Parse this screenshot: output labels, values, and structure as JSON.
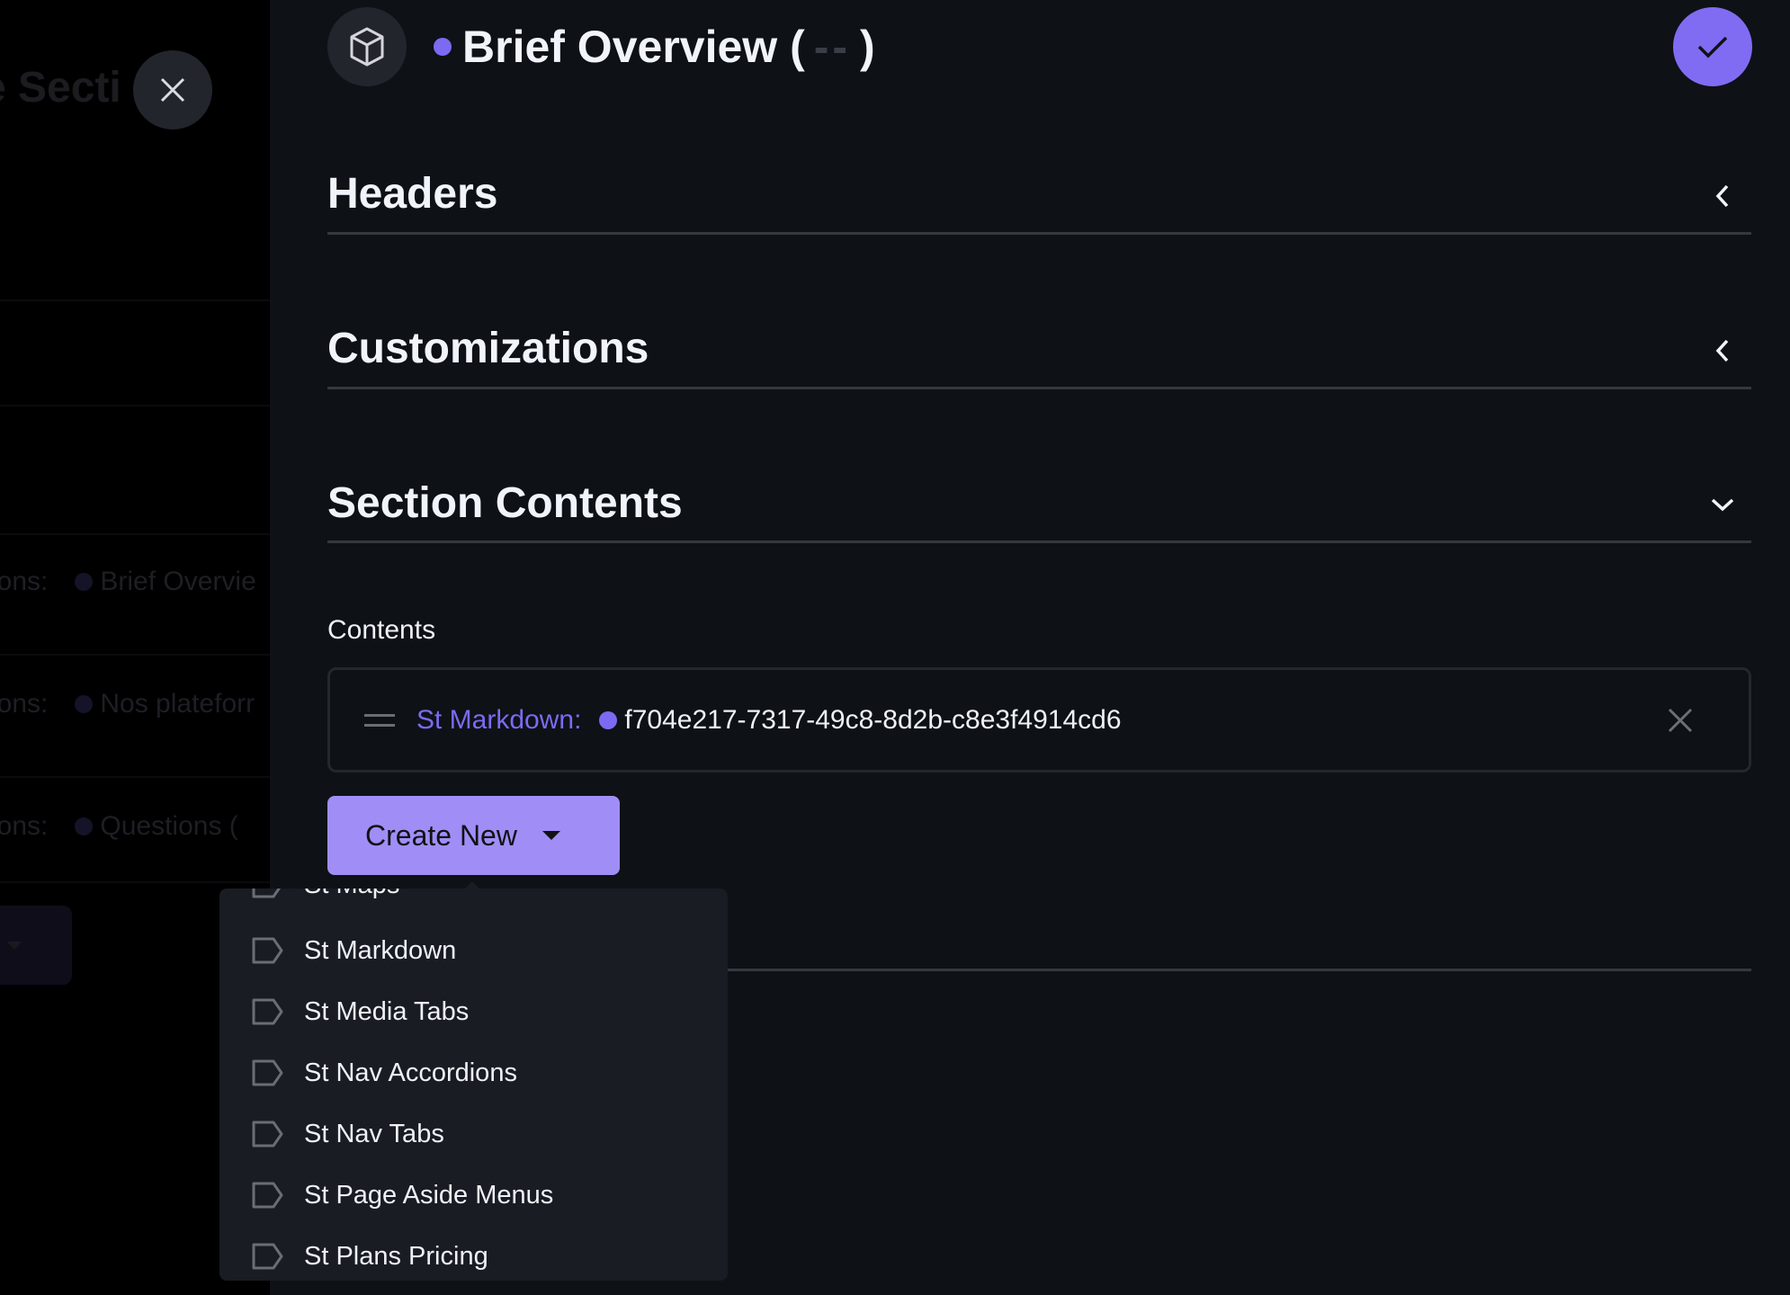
{
  "background": {
    "title_fragment": "e Secti",
    "rows": [
      {
        "label": "ions:",
        "value": "Brief Overvie"
      },
      {
        "label": "ions:",
        "value": "Nos plateforr"
      },
      {
        "label": "ions:",
        "value": "Questions ("
      }
    ]
  },
  "header": {
    "icon": "cube-icon",
    "title": "Brief Overview (",
    "title_placeholder": "--",
    "title_close": ")",
    "accent_color": "#7c6af2"
  },
  "sections": [
    {
      "title": "Headers",
      "state": "collapsed"
    },
    {
      "title": "Customizations",
      "state": "collapsed"
    },
    {
      "title": "Section Contents",
      "state": "expanded"
    }
  ],
  "contents": {
    "label": "Contents",
    "items": [
      {
        "type": "St Markdown:",
        "id": "f704e217-7317-49c8-8d2b-c8e3f4914cd6"
      }
    ],
    "create_button": "Create New"
  },
  "menu": {
    "items": [
      "St Maps",
      "St Markdown",
      "St Media Tabs",
      "St Nav Accordions",
      "St Nav Tabs",
      "St Page Aside Menus",
      "St Plans Pricing"
    ]
  }
}
